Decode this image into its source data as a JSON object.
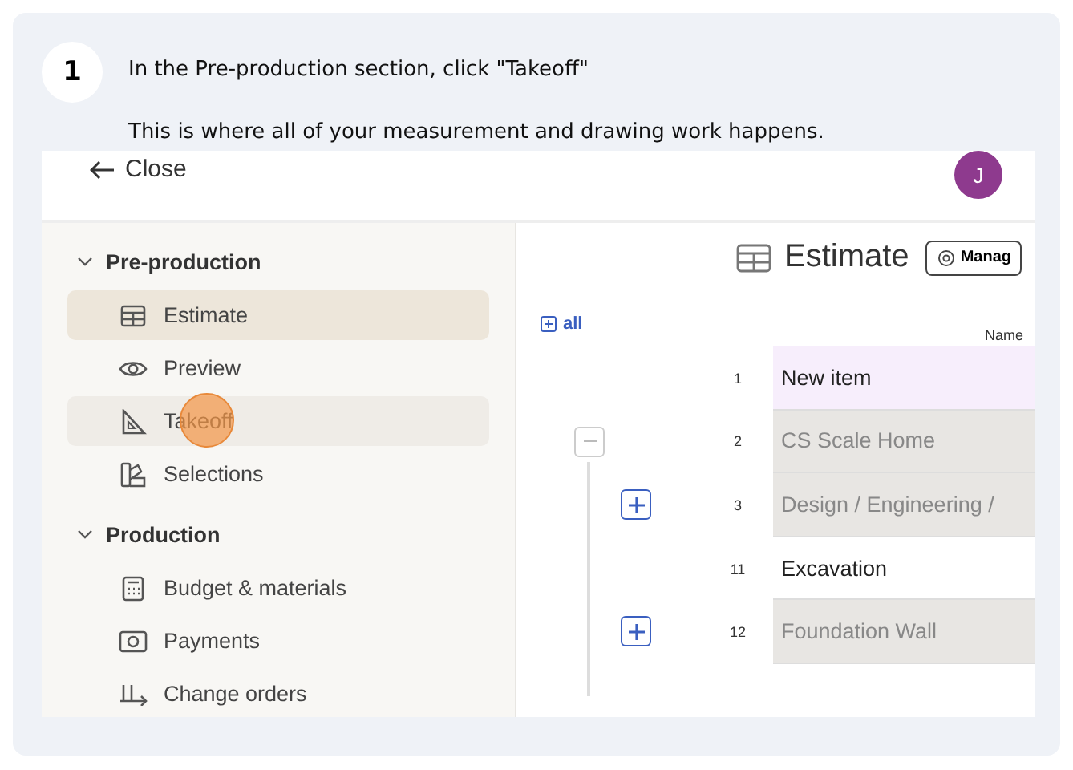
{
  "step": {
    "number": "1",
    "title": "In the Pre-production section, click \"Takeoff\"",
    "description": "This is where all of your measurement and drawing work happens."
  },
  "app": {
    "close": "Close",
    "avatar": "J",
    "sections": [
      {
        "title": "Pre-production",
        "expanded": true,
        "items": [
          {
            "label": "Estimate",
            "selected": true,
            "highlighted": false
          },
          {
            "label": "Preview",
            "selected": false,
            "highlighted": false
          },
          {
            "label": "Takeoff",
            "selected": false,
            "highlighted": true,
            "clicked": true
          },
          {
            "label": "Selections",
            "selected": false,
            "highlighted": false
          }
        ]
      },
      {
        "title": "Production",
        "expanded": true,
        "items": [
          {
            "label": "Budget & materials",
            "selected": false,
            "highlighted": false
          },
          {
            "label": "Payments",
            "selected": false,
            "highlighted": false
          },
          {
            "label": "Change orders",
            "selected": false,
            "highlighted": false
          }
        ]
      }
    ],
    "page_title": "Estimate",
    "manage_button": "Manag",
    "expand_all": "all",
    "name_header": "Name",
    "rows": [
      {
        "number": "1",
        "name": "New item",
        "kind": "new"
      },
      {
        "number": "2",
        "name": "CS Scale Home",
        "kind": "group",
        "expanded": true
      },
      {
        "number": "3",
        "name": "Design / Engineering /",
        "kind": "group",
        "expanded": false
      },
      {
        "number": "11",
        "name": "Excavation",
        "kind": "item"
      },
      {
        "number": "12",
        "name": "Foundation Wall",
        "kind": "group",
        "expanded": false
      }
    ]
  }
}
